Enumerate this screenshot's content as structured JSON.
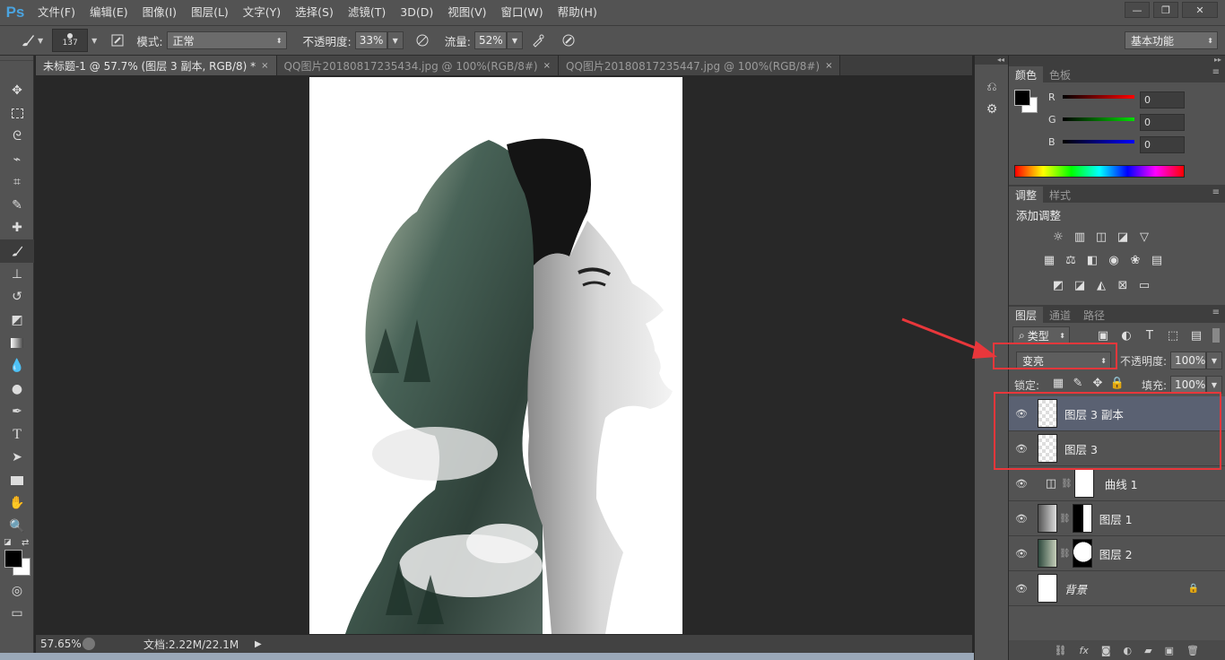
{
  "app": {
    "logo": "Ps"
  },
  "menu": [
    "文件(F)",
    "编辑(E)",
    "图像(I)",
    "图层(L)",
    "文字(Y)",
    "选择(S)",
    "滤镜(T)",
    "3D(D)",
    "视图(V)",
    "窗口(W)",
    "帮助(H)"
  ],
  "window_buttons": [
    "—",
    "❐",
    "✕"
  ],
  "options": {
    "brush_size": "137",
    "mode_label": "模式:",
    "mode_value": "正常",
    "opacity_label": "不透明度:",
    "opacity_value": "33%",
    "flow_label": "流量:",
    "flow_value": "52%",
    "workspace": "基本功能"
  },
  "tabs": [
    {
      "label": "未标题-1 @ 57.7% (图层 3 副本, RGB/8) *",
      "close": "×"
    },
    {
      "label": "QQ图片20180817235434.jpg @ 100%(RGB/8#)",
      "close": "×"
    },
    {
      "label": "QQ图片20180817235447.jpg @ 100%(RGB/8#)",
      "close": "×"
    }
  ],
  "status": {
    "zoom": "57.65%",
    "doc": "文档:2.22M/22.1M"
  },
  "color_panel": {
    "tabs": [
      "颜色",
      "色板"
    ],
    "channels": [
      {
        "name": "R",
        "value": "0",
        "color": "#e01010"
      },
      {
        "name": "G",
        "value": "0",
        "color": "#10c010"
      },
      {
        "name": "B",
        "value": "0",
        "color": "#1010e0"
      }
    ]
  },
  "adjust_panel": {
    "tabs": [
      "调整",
      "样式"
    ],
    "title": "添加调整"
  },
  "layers_panel": {
    "tabs": [
      "图层",
      "通道",
      "路径"
    ],
    "filter_kind": "类型",
    "blend_mode": "变亮",
    "opacity_label": "不透明度:",
    "opacity_value": "100%",
    "lock_label": "锁定:",
    "fill_label": "填充:",
    "fill_value": "100%",
    "layers": [
      {
        "name": "图层 3 副本",
        "selected": true
      },
      {
        "name": "图层 3",
        "selected": false
      },
      {
        "name": "曲线 1",
        "selected": false
      },
      {
        "name": "图层 1",
        "selected": false
      },
      {
        "name": "图层 2",
        "selected": false
      },
      {
        "name": "背景",
        "selected": false
      }
    ]
  },
  "colors": {
    "accent": "#4aa3df",
    "highlight": "#e8373b",
    "selected_layer": "#5a6172"
  }
}
